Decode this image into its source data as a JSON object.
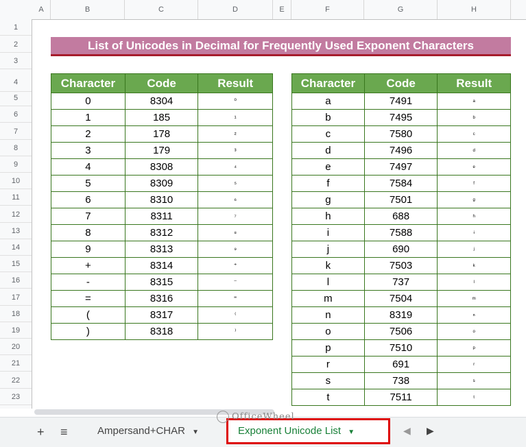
{
  "columns": [
    "A",
    "B",
    "C",
    "D",
    "E",
    "F",
    "G",
    "H"
  ],
  "rows": [
    "1",
    "2",
    "3",
    "4",
    "5",
    "6",
    "7",
    "8",
    "9",
    "10",
    "11",
    "12",
    "13",
    "14",
    "15",
    "16",
    "17",
    "18",
    "19",
    "20",
    "21",
    "22",
    "23"
  ],
  "title": "List of Unicodes in Decimal for Frequently Used Exponent Characters",
  "headers": {
    "character": "Character",
    "code": "Code",
    "result": "Result"
  },
  "left_table": [
    [
      "0",
      "8304",
      "⁰"
    ],
    [
      "1",
      "185",
      "¹"
    ],
    [
      "2",
      "178",
      "²"
    ],
    [
      "3",
      "179",
      "³"
    ],
    [
      "4",
      "8308",
      "⁴"
    ],
    [
      "5",
      "8309",
      "⁵"
    ],
    [
      "6",
      "8310",
      "⁶"
    ],
    [
      "7",
      "8311",
      "⁷"
    ],
    [
      "8",
      "8312",
      "⁸"
    ],
    [
      "9",
      "8313",
      "⁹"
    ],
    [
      "+",
      "8314",
      "⁺"
    ],
    [
      "-",
      "8315",
      "⁻"
    ],
    [
      "=",
      "8316",
      "⁼"
    ],
    [
      "(",
      "8317",
      "⁽"
    ],
    [
      ")",
      "8318",
      "⁾"
    ]
  ],
  "right_table": [
    [
      "a",
      "7491",
      "ᵃ"
    ],
    [
      "b",
      "7495",
      "ᵇ"
    ],
    [
      "c",
      "7580",
      "ᶜ"
    ],
    [
      "d",
      "7496",
      "ᵈ"
    ],
    [
      "e",
      "7497",
      "ᵉ"
    ],
    [
      "f",
      "7584",
      "ᶠ"
    ],
    [
      "g",
      "7501",
      "ᵍ"
    ],
    [
      "h",
      "688",
      "ʰ"
    ],
    [
      "i",
      "7588",
      "ᶤ"
    ],
    [
      "j",
      "690",
      "ʲ"
    ],
    [
      "k",
      "7503",
      "ᵏ"
    ],
    [
      "l",
      "737",
      "ˡ"
    ],
    [
      "m",
      "7504",
      "ᵐ"
    ],
    [
      "n",
      "8319",
      "ⁿ"
    ],
    [
      "o",
      "7506",
      "ᵒ"
    ],
    [
      "p",
      "7510",
      "ᵖ"
    ],
    [
      "r",
      "691",
      "ʳ"
    ],
    [
      "s",
      "738",
      "ˢ"
    ],
    [
      "t",
      "7511",
      "ᵗ"
    ]
  ],
  "tabs": {
    "add": "+",
    "menu": "≡",
    "sheet1": "Ampersand+CHAR",
    "sheet2": "Exponent Unicode List",
    "caret": "▼",
    "prev": "◀",
    "next": "▶"
  },
  "watermark": "OfficeWheel",
  "colors": {
    "title_bg": "#c27ba0",
    "header_bg": "#6aa84f",
    "active_tab": "#188038",
    "highlight": "#dd0000"
  }
}
